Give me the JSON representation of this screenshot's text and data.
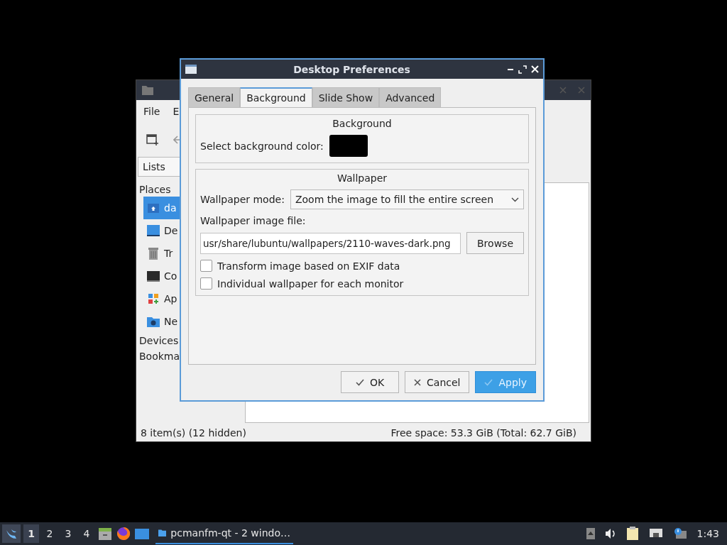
{
  "file_manager": {
    "menu": [
      "File",
      "E"
    ],
    "side_tab": "Lists",
    "places_header": "Places",
    "places": [
      {
        "label": "da",
        "kind": "home",
        "selected": true
      },
      {
        "label": "De",
        "kind": "desktop",
        "selected": false
      },
      {
        "label": "Tr",
        "kind": "trash",
        "selected": false
      },
      {
        "label": "Co",
        "kind": "computer",
        "selected": false
      },
      {
        "label": "Ap",
        "kind": "apps",
        "selected": false
      },
      {
        "label": "Ne",
        "kind": "network",
        "selected": false
      }
    ],
    "sections": [
      "Devices",
      "Bookma"
    ],
    "status_left": "8 item(s) (12 hidden)",
    "status_right": "Free space: 53.3 GiB (Total: 62.7 GiB)"
  },
  "dialog": {
    "title": "Desktop Preferences",
    "tabs": [
      {
        "label": "General",
        "selected": false
      },
      {
        "label": "Background",
        "selected": true
      },
      {
        "label": "Slide Show",
        "selected": false
      },
      {
        "label": "Advanced",
        "selected": false
      }
    ],
    "background_group": {
      "title": "Background",
      "color_label": "Select background color:",
      "color": "#000000"
    },
    "wallpaper_group": {
      "title": "Wallpaper",
      "mode_label": "Wallpaper mode:",
      "mode_value": "Zoom the image to fill the entire screen",
      "file_label": "Wallpaper image file:",
      "file_value": "usr/share/lubuntu/wallpapers/2110-waves-dark.png",
      "browse": "Browse",
      "options": [
        {
          "label": "Transform image based on EXIF data",
          "checked": false
        },
        {
          "label": "Individual wallpaper for each monitor",
          "checked": false
        }
      ]
    },
    "buttons": [
      {
        "label": "OK",
        "kind": "accept",
        "default": false
      },
      {
        "label": "Cancel",
        "kind": "reject",
        "default": false
      },
      {
        "label": "Apply",
        "kind": "accept",
        "default": true
      }
    ]
  },
  "taskbar": {
    "desktops": [
      {
        "label": "1",
        "selected": true
      },
      {
        "label": "2",
        "selected": false
      },
      {
        "label": "3",
        "selected": false
      },
      {
        "label": "4",
        "selected": false
      }
    ],
    "task": "pcmanfm-qt - 2 windo…",
    "clock": "1:43"
  }
}
